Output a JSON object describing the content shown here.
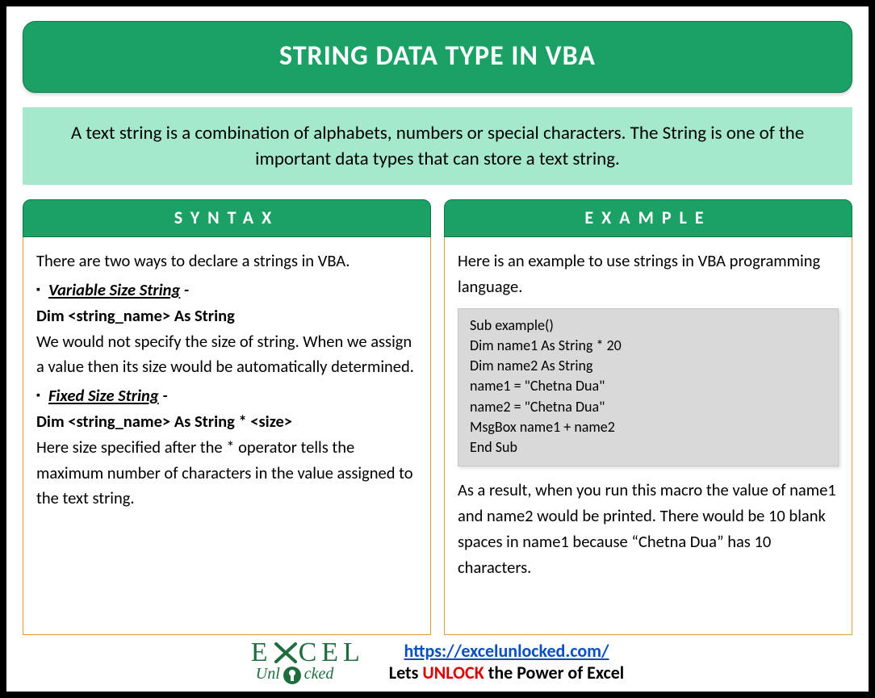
{
  "title": "STRING DATA TYPE IN VBA",
  "intro": "A text string is a combination of alphabets, numbers or special characters. The String is one of the important data types that can store a text string.",
  "columns": {
    "syntax": {
      "header": "SYNTAX",
      "lead": "There are two ways to declare a strings in VBA.",
      "item1_title": "Variable Size String",
      "item1_dash": " -",
      "item1_decl": "Dim <string_name> As String",
      "item1_desc": "We would not specify the size of string. When we assign a value then its size would be automatically determined.",
      "item2_title": "Fixed Size String",
      "item2_dash": " -",
      "item2_decl": "Dim <string_name> As String * <size>",
      "item2_desc": "Here size specified after the * operator tells the maximum number of characters in the value assigned to the text string."
    },
    "example": {
      "header": "EXAMPLE",
      "lead": "Here is an example to use strings in VBA programming language.",
      "code": {
        "l1": "Sub example()",
        "l2": "Dim name1 As String * 20",
        "l3": "Dim name2 As String",
        "l4": "name1 = \"Chetna Dua\"",
        "l5": "name2 = \"Chetna Dua\"",
        "l6": "MsgBox name1 + name2",
        "l7": "End Sub"
      },
      "result": "As a result, when you run this macro the value of name1 and name2 would be printed. There would be 10 blank spaces in name1 because “Chetna Dua” has 10 characters."
    }
  },
  "footer": {
    "logo_top_1": "E",
    "logo_top_2": "CEL",
    "logo_bottom_1": "Unl",
    "logo_bottom_2": "cked",
    "url_text": "https://excelunlocked.com/",
    "url_href": "https://excelunlocked.com/",
    "tagline_1": "Lets ",
    "tagline_unlock": "UNLOCK",
    "tagline_2": " the Power of Excel"
  }
}
